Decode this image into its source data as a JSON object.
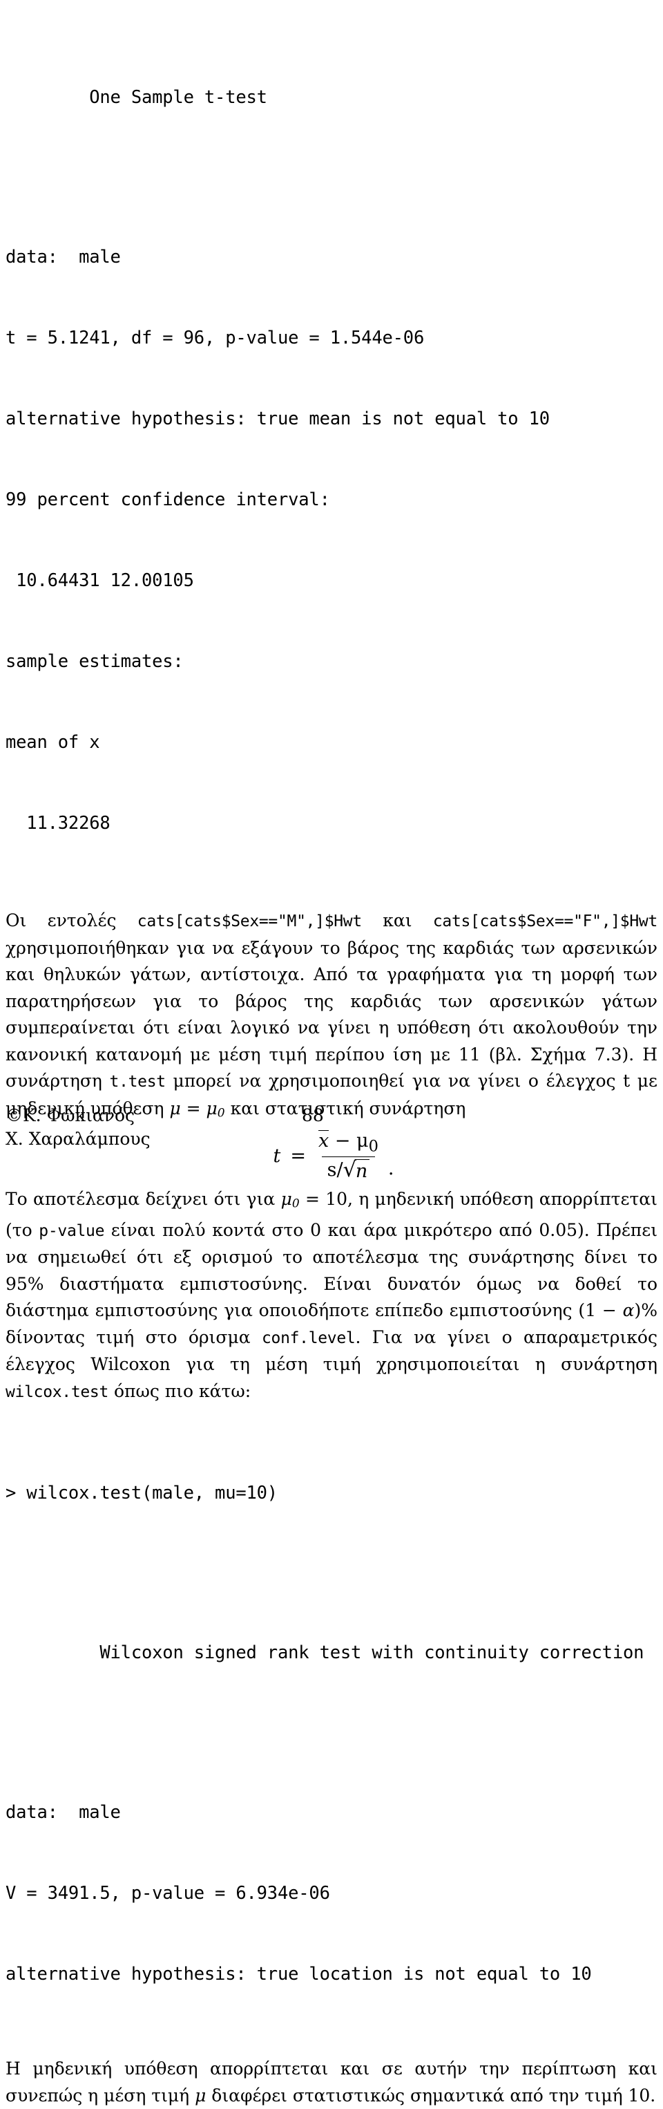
{
  "document": {
    "page_number": "88",
    "language": "el"
  },
  "ttest_output": {
    "title": "One Sample t-test",
    "title_indent_spaces": "        ",
    "lines": [
      "data:  male",
      "t = 5.1241, df = 96, p-value = 1.544e-06",
      "alternative hypothesis: true mean is not equal to 10",
      "99 percent confidence interval:",
      " 10.64431 12.00105",
      "sample estimates:",
      "mean of x",
      "  11.32268"
    ]
  },
  "paragraph1": {
    "seg1": "Οι εντολές ",
    "code1": "cats[cats$Sex==\"M\",]$Hwt",
    "seg2": " και ",
    "code2": "cats[cats$Sex==\"F\",]$Hwt",
    "seg3": " χρησιμοποιήθηκαν για να εξάγουν το βάρος της καρδιάς των αρσενικών και θηλυκών γάτων, αντίστοιχα.  Από τα γραφήματα για τη μορφή των παρατηρήσεων για το βάρος της καρδιάς των αρσενικών γάτων συμπεραίνεται ότι είναι λογικό να γίνει η υπόθεση ότι ακολουθούν την κανονική κατανομή με μέση τιμή περίπου ίση με 11 (βλ. Σχήμα 7.3). Η συνάρτηση ",
    "code3": "t.test",
    "seg4": " μπορεί να χρησιμοποιηθεί για να γίνει ο έλεγχος t με μηδενική υπόθεση ",
    "math_mu": "μ",
    "math_eq": " = ",
    "math_mu0_base": "μ",
    "math_mu0_sub": "0",
    "seg5": " και στατιστική συνάρτηση"
  },
  "formula": {
    "lhs": "t",
    "equals": "=",
    "numerator_var": "x",
    "numerator_minus": "−",
    "numerator_mu": "μ",
    "numerator_mu_sub": "0",
    "denominator_s": "s",
    "denominator_slash": "/",
    "radical": "√",
    "radicand": "n",
    "trailing": "."
  },
  "paragraph2": {
    "seg1": "Το αποτέλεσμα δείχνει ότι για ",
    "math_mu0_base": "μ",
    "math_mu0_sub": "0",
    "seg2": " = 10, η μηδενική υπόθεση απορρίπτεται (το ",
    "code1": "p-value",
    "seg3": " είναι πολύ κοντά στο 0 και άρα μικρότερο από 0.05).  Πρέπει να σημειωθεί ότι εξ ορισμού το αποτέλεσμα της συνάρτησης δίνει το 95% διαστήματα εμπιστοσύνης.  Είναι δυνατόν όμως να δοθεί το διάστημα εμπιστοσύνης για οποιοδήποτε επίπεδο εμπιστοσύνης ",
    "math_alpha_open": "(1 − ",
    "math_alpha": "α",
    "math_alpha_close": ")%",
    "seg4": " δίνοντας τιμή στο όρισμα ",
    "code2": "conf.level",
    "seg5": ". Για να γίνει ο απαραμετρικός έλεγχος Wilcoxon για τη μέση τιμή χρησιμοποιείται η συνάρτηση ",
    "code3": "wilcox.test",
    "seg6": " όπως πιο κάτω:"
  },
  "command": {
    "prompt_line": "> wilcox.test(male, mu=10)"
  },
  "wilcox_output": {
    "title": "Wilcoxon signed rank test with continuity correction",
    "title_indent_spaces": "         ",
    "lines": [
      "data:  male",
      "V = 3491.5, p-value = 6.934e-06",
      "alternative hypothesis: true location is not equal to 10"
    ]
  },
  "paragraph3": {
    "seg1": "Η μηδενική υπόθεση απορρίπτεται και σε αυτήν την περίπτωση και συνεπώς η μέση τιμή ",
    "math_mu": "μ",
    "seg2": " διαφέρει στατιστικώς σημαντικά από την τιμή 10."
  },
  "footer": {
    "author1": "©Κ. Φωκιανός",
    "author2": "Χ. Χαραλάμπους",
    "page": "88"
  }
}
